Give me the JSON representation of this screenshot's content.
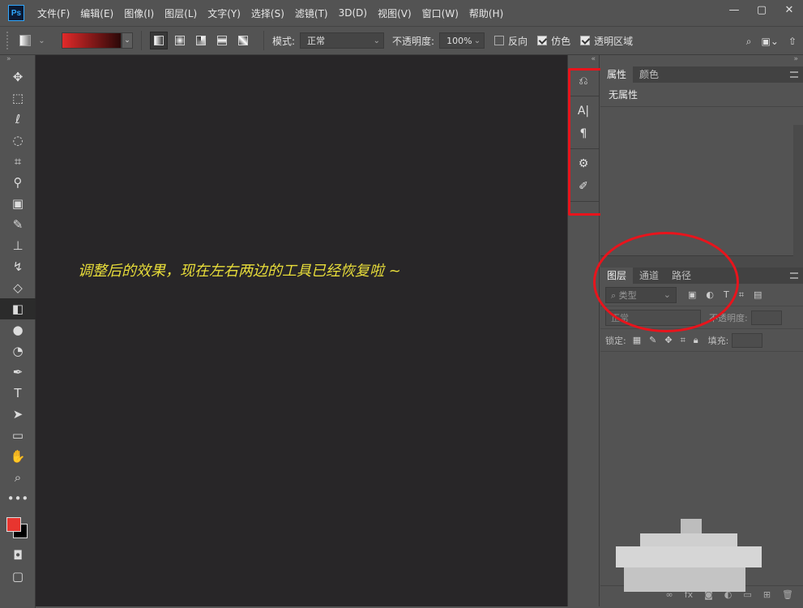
{
  "app": {
    "logo_text": "Ps"
  },
  "menu": [
    {
      "label": "文件(F)"
    },
    {
      "label": "编辑(E)"
    },
    {
      "label": "图像(I)"
    },
    {
      "label": "图层(L)"
    },
    {
      "label": "文字(Y)"
    },
    {
      "label": "选择(S)"
    },
    {
      "label": "滤镜(T)"
    },
    {
      "label": "3D(D)"
    },
    {
      "label": "视图(V)"
    },
    {
      "label": "窗口(W)"
    },
    {
      "label": "帮助(H)"
    }
  ],
  "window_controls": {
    "minimize": "—",
    "maximize": "▢",
    "close": "✕"
  },
  "options": {
    "mode_label": "模式:",
    "mode_value": "正常",
    "opacity_label": "不透明度:",
    "opacity_value": "100%",
    "reverse_label": "反向",
    "dither_label": "仿色",
    "transparency_label": "透明区域",
    "reverse_checked": false,
    "dither_checked": true,
    "transparency_checked": true,
    "gradient_colors": [
      "#e22a2a",
      "#2a0808"
    ]
  },
  "tools": [
    {
      "name": "move-tool",
      "icon": "✥"
    },
    {
      "name": "marquee-tool",
      "icon": "⬚"
    },
    {
      "name": "lasso-tool",
      "icon": "ℓ"
    },
    {
      "name": "quick-select-tool",
      "icon": "◌"
    },
    {
      "name": "crop-tool",
      "icon": "⌗"
    },
    {
      "name": "eyedropper-tool",
      "icon": "⚲"
    },
    {
      "name": "patch-tool",
      "icon": "▣"
    },
    {
      "name": "brush-tool",
      "icon": "✎"
    },
    {
      "name": "stamp-tool",
      "icon": "⊥"
    },
    {
      "name": "history-brush-tool",
      "icon": "↯"
    },
    {
      "name": "eraser-tool",
      "icon": "◇"
    },
    {
      "name": "gradient-tool",
      "icon": "◧",
      "active": true
    },
    {
      "name": "blur-tool",
      "icon": "●"
    },
    {
      "name": "dodge-tool",
      "icon": "◔"
    },
    {
      "name": "pen-tool",
      "icon": "✒"
    },
    {
      "name": "type-tool",
      "icon": "T"
    },
    {
      "name": "path-select-tool",
      "icon": "➤"
    },
    {
      "name": "rectangle-tool",
      "icon": "▭"
    },
    {
      "name": "hand-tool",
      "icon": "✋"
    },
    {
      "name": "zoom-tool",
      "icon": "⌕"
    },
    {
      "name": "more-tools",
      "icon": "•••"
    }
  ],
  "colors": {
    "foreground": "#e8352f",
    "background": "#000000"
  },
  "canvas": {
    "background": "#282628",
    "note": "调整后的效果，现在左右两边的工具已经恢复啦 ~",
    "note_color": "#e9de3a"
  },
  "strip_icons": [
    {
      "name": "history-icon",
      "icon": "⎌"
    },
    {
      "name": "character-icon",
      "icon": "A|"
    },
    {
      "name": "paragraph-icon",
      "icon": "¶"
    },
    {
      "name": "adjustments-icon",
      "icon": "⚙"
    },
    {
      "name": "brush-settings-icon",
      "icon": "✐"
    }
  ],
  "properties_panel": {
    "tabs": [
      {
        "label": "属性",
        "active": true
      },
      {
        "label": "颜色",
        "active": false
      }
    ],
    "empty_text": "无属性"
  },
  "layers_panel": {
    "tabs": [
      {
        "label": "图层",
        "active": true
      },
      {
        "label": "通道",
        "active": false
      },
      {
        "label": "路径",
        "active": false
      }
    ],
    "filter_placeholder": "类型",
    "blend_mode": "正常",
    "opacity_label": "不透明度:",
    "lock_label": "锁定:",
    "fill_label": "填充:"
  },
  "annotation_color": "#e8141c"
}
